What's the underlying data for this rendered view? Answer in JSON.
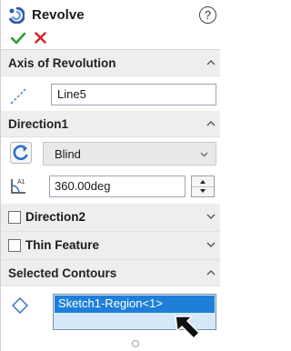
{
  "title": "Revolve",
  "help_glyph": "?",
  "icons": {
    "feature": "revolve-icon",
    "help": "help-icon",
    "ok": "checkmark-icon",
    "cancel": "close-icon",
    "axis": "axis-line-icon",
    "reverse": "reverse-direction-icon",
    "angle": "angle-icon",
    "contours": "contour-diamond-icon"
  },
  "colors": {
    "ok": "#2aa02a",
    "cancel": "#d62020",
    "selection": "#1f7fd8",
    "listbox_bg": "#d5e8fa"
  },
  "axis_of_revolution": {
    "header": "Axis of Revolution",
    "value": "Line5"
  },
  "direction1": {
    "header": "Direction1",
    "end_condition": "Blind",
    "angle": "360.00deg"
  },
  "direction2": {
    "label": "Direction2",
    "checked": false
  },
  "thin_feature": {
    "label": "Thin Feature",
    "checked": false
  },
  "selected_contours": {
    "header": "Selected Contours",
    "items": [
      "Sketch1-Region<1>"
    ]
  }
}
